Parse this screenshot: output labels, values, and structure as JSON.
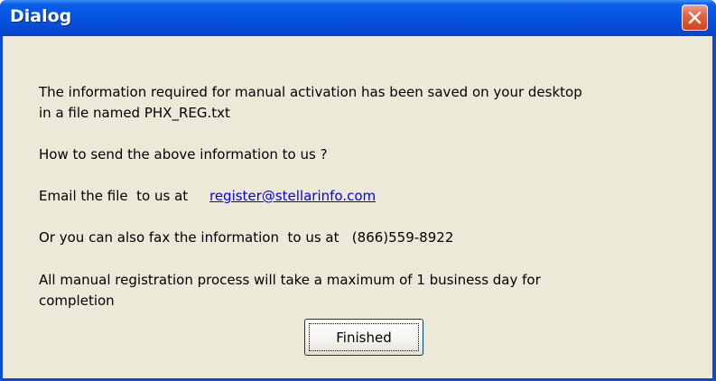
{
  "window": {
    "title": "Dialog",
    "title_bar_color": "#0553e0",
    "client_bg_color": "#ece9d8",
    "close_button_color": "#e2653f"
  },
  "message": {
    "line1": "The information required for manual activation has been saved on your desktop",
    "line2": "in a file named PHX_REG.txt",
    "how_to_send": "How to send the above information to us ?",
    "email_prefix": "Email the file  to us at     ",
    "email_link": "register@stellarinfo.com",
    "fax_line": "Or you can also fax the information  to us at   (866)559-8922",
    "completion_line1": "All manual registration process will take a maximum of 1 business day for",
    "completion_line2": "completion"
  },
  "buttons": {
    "finished_label": "Finished"
  },
  "icons": {
    "close": "close-x-icon"
  },
  "link_color": "#0000ff"
}
